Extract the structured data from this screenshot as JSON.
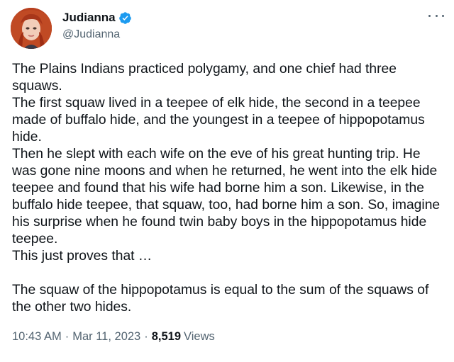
{
  "author": {
    "display_name": "Judianna",
    "handle": "@Judianna",
    "verified_icon": "verified-badge-icon",
    "accent_color": "#1d9bf0"
  },
  "menu_icon": "more-horizontal-icon",
  "tweet": {
    "text": "The Plains Indians practiced polygamy, and one chief had three squaws.\nThe first squaw lived in a teepee of elk hide, the second in a teepee made of buffalo hide, and the youngest in a teepee of hippopotamus hide.\nThen he slept with each wife on the eve of his great hunting trip. He was gone nine moons and when he returned, he went into the elk hide teepee and found that his wife had borne him a son. Likewise, in the buffalo hide teepee, that squaw, too, had borne him a son. So, imagine his surprise when he found twin baby boys in the hippopotamus hide teepee.\nThis just proves that …\n\nThe squaw of the hippopotamus is equal to the sum of the squaws of the other two hides."
  },
  "meta": {
    "time": "10:43 AM",
    "separator": "·",
    "date": "Mar 11, 2023",
    "separator2": "·",
    "views_count": "8,519",
    "views_label": "Views"
  }
}
